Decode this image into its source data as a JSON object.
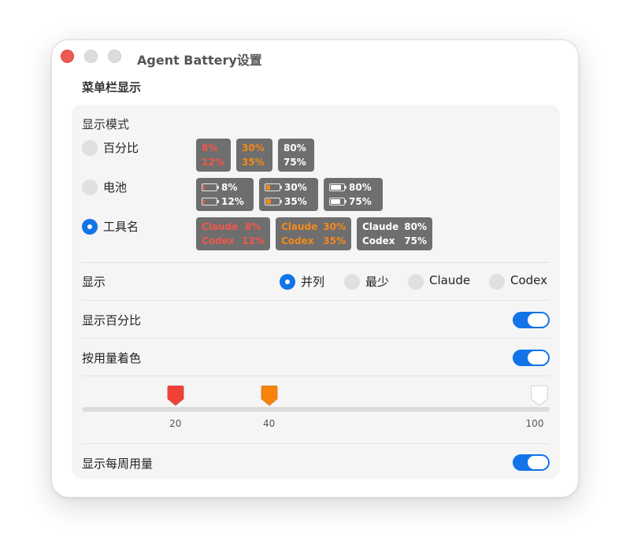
{
  "window": {
    "title": "Agent Battery设置"
  },
  "section": {
    "title": "菜单栏显示"
  },
  "display_mode": {
    "label": "显示模式",
    "options": [
      {
        "label": "百分比",
        "selected": false
      },
      {
        "label": "电池",
        "selected": false
      },
      {
        "label": "工具名",
        "selected": true
      }
    ],
    "percent_previews": [
      {
        "top": "8%",
        "bottom": "12%",
        "tone": "red"
      },
      {
        "top": "30%",
        "bottom": "35%",
        "tone": "orange"
      },
      {
        "top": "80%",
        "bottom": "75%",
        "tone": "white"
      }
    ],
    "battery_previews": [
      {
        "top": "8%",
        "bottom": "12%",
        "top_level": 0.08,
        "bottom_level": 0.12,
        "fill_color": "#f2574a"
      },
      {
        "top": "30%",
        "bottom": "35%",
        "top_level": 0.3,
        "bottom_level": 0.35,
        "fill_color": "#f5891b"
      },
      {
        "top": "80%",
        "bottom": "75%",
        "top_level": 0.8,
        "bottom_level": 0.75,
        "fill_color": "#ffffff"
      }
    ],
    "tool_previews": [
      {
        "top_name": "Claude",
        "top": "8%",
        "bottom_name": "Codex",
        "bottom": "12%",
        "tone": "red"
      },
      {
        "top_name": "Claude",
        "top": "30%",
        "bottom_name": "Codex",
        "bottom": "35%",
        "tone": "orange"
      },
      {
        "top_name": "Claude",
        "top": "80%",
        "bottom_name": "Codex",
        "bottom": "75%",
        "tone": "white"
      }
    ]
  },
  "show": {
    "label": "显示",
    "options": [
      {
        "label": "并列",
        "selected": true
      },
      {
        "label": "最少",
        "selected": false
      },
      {
        "label": "Claude",
        "selected": false
      },
      {
        "label": "Codex",
        "selected": false
      }
    ]
  },
  "show_percent": {
    "label": "显示百分比",
    "on": true
  },
  "color_by_usage": {
    "label": "按用量着色",
    "on": true
  },
  "threshold_slider": {
    "min": 0,
    "max": 100,
    "thumbs": [
      {
        "value": 20,
        "label": "20",
        "color": "#ef4136"
      },
      {
        "value": 40,
        "label": "40",
        "color": "#f7820c"
      },
      {
        "value": 100,
        "label": "100",
        "color": "#ffffff"
      }
    ]
  },
  "show_weekly": {
    "label": "显示每周用量",
    "on": true
  },
  "colors": {
    "accent": "#1274e8",
    "red": "#f2574a",
    "orange": "#f5891b"
  }
}
